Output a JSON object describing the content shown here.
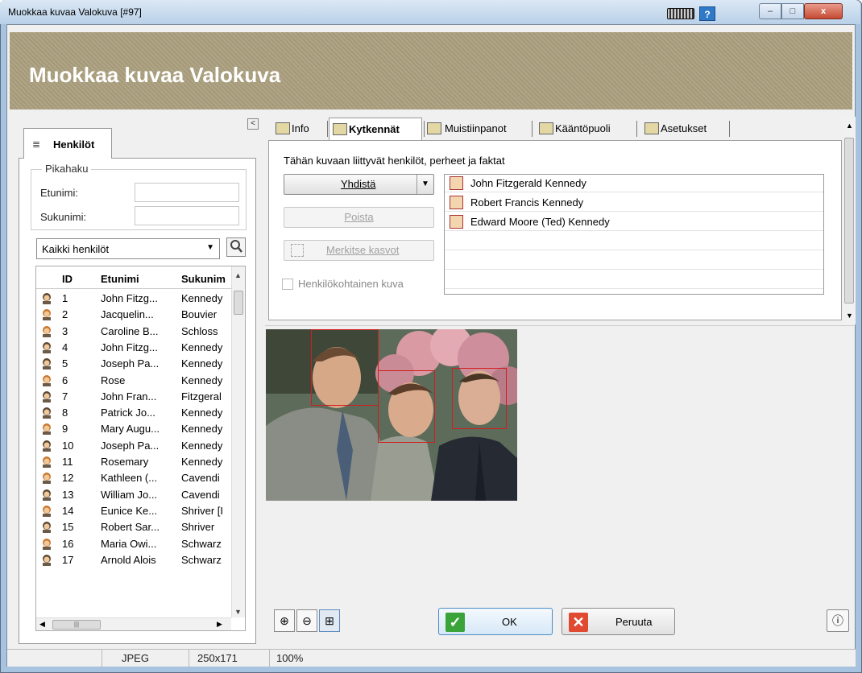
{
  "window": {
    "title": "Muokkaa kuvaa Valokuva [#97]",
    "help_label": "?",
    "min_label": "–",
    "max_label": "□",
    "close_label": "x"
  },
  "banner": {
    "title": "Muokkaa kuvaa Valokuva"
  },
  "left": {
    "collapse_label": "<",
    "tab_label": "Henkilöt",
    "quick_search": {
      "legend": "Pikahaku",
      "first_name_label": "Etunimi:",
      "last_name_label": "Sukunimi:",
      "first_name_value": "",
      "last_name_value": ""
    },
    "filter": {
      "selected": "Kaikki henkilöt"
    },
    "grid": {
      "headers": {
        "id": "ID",
        "first": "Etunimi",
        "last": "Sukunim"
      },
      "rows": [
        {
          "id": "1",
          "first": "John Fitzg...",
          "last": "Kennedy",
          "gender": "male"
        },
        {
          "id": "2",
          "first": "Jacquelin...",
          "last": "Bouvier",
          "gender": "female"
        },
        {
          "id": "3",
          "first": "Caroline B...",
          "last": "Schloss",
          "gender": "female"
        },
        {
          "id": "4",
          "first": "John Fitzg...",
          "last": "Kennedy",
          "gender": "male"
        },
        {
          "id": "5",
          "first": "Joseph Pa...",
          "last": "Kennedy",
          "gender": "male"
        },
        {
          "id": "6",
          "first": "Rose",
          "last": "Kennedy",
          "gender": "female"
        },
        {
          "id": "7",
          "first": "John Fran...",
          "last": "Fitzgeral",
          "gender": "male"
        },
        {
          "id": "8",
          "first": "Patrick Jo...",
          "last": "Kennedy",
          "gender": "male"
        },
        {
          "id": "9",
          "first": "Mary Augu...",
          "last": "Kennedy",
          "gender": "female"
        },
        {
          "id": "10",
          "first": "Joseph Pa...",
          "last": "Kennedy",
          "gender": "male"
        },
        {
          "id": "11",
          "first": "Rosemary",
          "last": "Kennedy",
          "gender": "female"
        },
        {
          "id": "12",
          "first": "Kathleen (...",
          "last": "Cavendi",
          "gender": "female"
        },
        {
          "id": "13",
          "first": "William Jo...",
          "last": "Cavendi",
          "gender": "male"
        },
        {
          "id": "14",
          "first": "Eunice Ke...",
          "last": "Shriver [I",
          "gender": "female"
        },
        {
          "id": "15",
          "first": "Robert Sar...",
          "last": "Shriver",
          "gender": "male"
        },
        {
          "id": "16",
          "first": "Maria Owi...",
          "last": "Schwarz",
          "gender": "female"
        },
        {
          "id": "17",
          "first": "Arnold Alois",
          "last": "Schwarz",
          "gender": "male"
        }
      ]
    }
  },
  "tabs": [
    {
      "label": "Info"
    },
    {
      "label": "Kytkennät"
    },
    {
      "label": "Muistiinpanot"
    },
    {
      "label": "Kääntöpuoli"
    },
    {
      "label": "Asetukset"
    }
  ],
  "connections": {
    "description": "Tähän kuvaan liittyvät henkilöt, perheet ja faktat",
    "connect_button": "Yhdistä",
    "remove_button": "Poista",
    "mark_faces_button": "Merkitse kasvot",
    "personal_photo_label": "Henkilökohtainen kuva",
    "linked": [
      "John Fitzgerald Kennedy",
      "Robert Francis Kennedy",
      "Edward Moore (Ted) Kennedy"
    ]
  },
  "buttons": {
    "ok": "OK",
    "cancel": "Peruuta"
  },
  "status": {
    "format": "JPEG",
    "dimensions": "250x171",
    "zoom": "100%"
  },
  "colors": {
    "banner": "#ab9f7e",
    "face_box": "#d21d1d",
    "ok_icon": "#3aa33a",
    "cancel_icon": "#e04a30"
  }
}
